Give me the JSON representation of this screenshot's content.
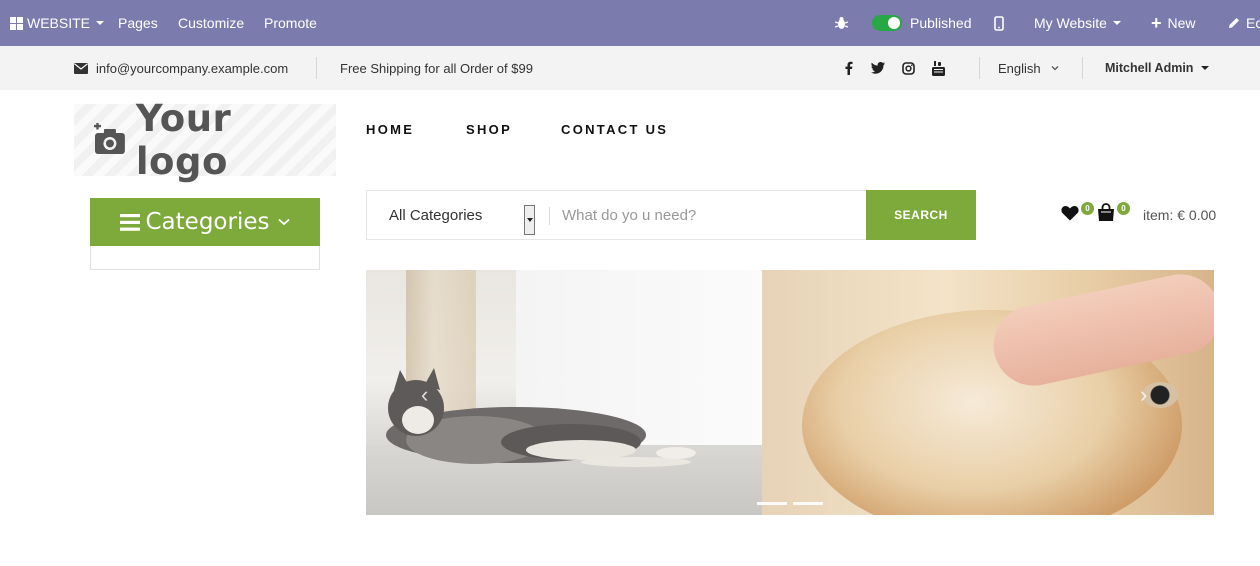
{
  "adminbar": {
    "website": "WEBSITE",
    "pages": "Pages",
    "customize": "Customize",
    "promote": "Promote",
    "published": "Published",
    "my_website": "My Website",
    "new": "New",
    "edit": "Ec"
  },
  "topbar": {
    "email": "info@yourcompany.example.com",
    "shipping": "Free Shipping for all Order of $99",
    "language": "English",
    "user": "Mitchell Admin"
  },
  "logo": {
    "text": "Your logo"
  },
  "nav": {
    "items": [
      "HOME",
      "SHOP",
      "CONTACT US"
    ]
  },
  "categories": {
    "label": "Categories"
  },
  "search": {
    "category": "All Categories",
    "placeholder": "What do yo u need?",
    "button": "SEARCH"
  },
  "wishlist": {
    "count": "0"
  },
  "cart": {
    "count": "0",
    "total": "item: € 0.00"
  },
  "colors": {
    "admin_bar": "#7c7bad",
    "accent": "#7ea93b",
    "published_toggle": "#28a745"
  }
}
